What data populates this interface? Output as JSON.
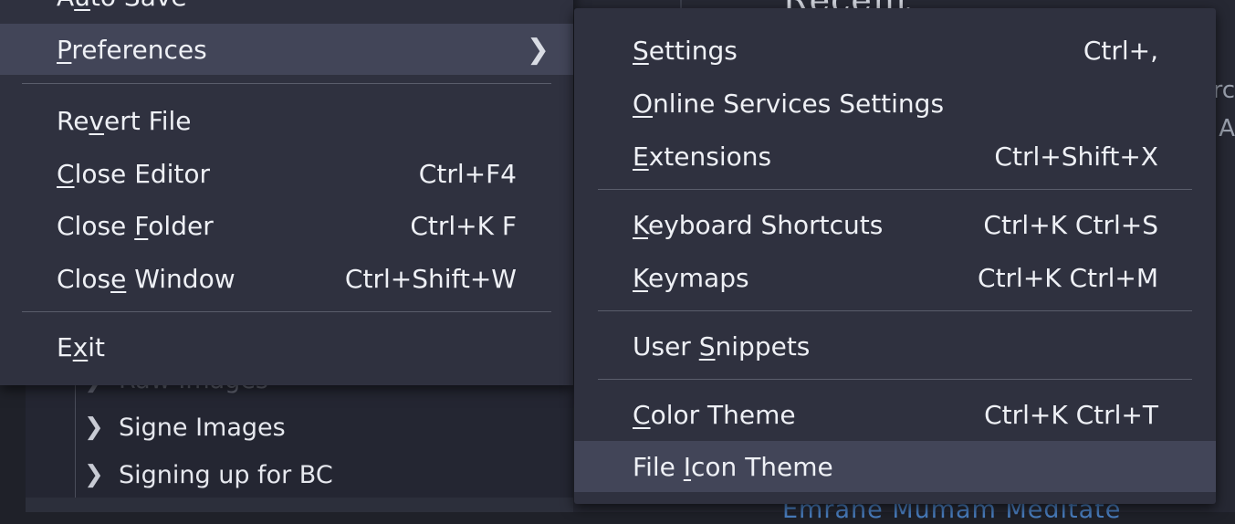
{
  "background": {
    "tree_items": [
      {
        "label": "Raw Images",
        "ghost": true
      },
      {
        "label": "Signe Images",
        "ghost": false
      },
      {
        "label": "Signing up for BC",
        "ghost": false
      }
    ],
    "chevron": "chevron-right-icon",
    "right_heading": "Recent",
    "edge_text_1": "rc",
    "edge_text_2": "A",
    "link_text": "Emrane Mumam Meditate"
  },
  "file_menu": {
    "items": [
      {
        "type": "item",
        "name": "auto-save",
        "label": "Auto Save",
        "mnemonic": {
          "before": "A",
          "key": "u",
          "after": "to Save"
        },
        "shortcut": ""
      },
      {
        "type": "item",
        "name": "preferences",
        "label": "Preferences",
        "mnemonic": {
          "before": "",
          "key": "P",
          "after": "references"
        },
        "shortcut": "",
        "submenu": true,
        "highlighted": true
      },
      {
        "type": "separator"
      },
      {
        "type": "item",
        "name": "revert-file",
        "label": "Revert File",
        "mnemonic": {
          "before": "Re",
          "key": "v",
          "after": "ert File"
        },
        "shortcut": ""
      },
      {
        "type": "item",
        "name": "close-editor",
        "label": "Close Editor",
        "mnemonic": {
          "before": "",
          "key": "C",
          "after": "lose Editor"
        },
        "shortcut": "Ctrl+F4"
      },
      {
        "type": "item",
        "name": "close-folder",
        "label": "Close Folder",
        "mnemonic": {
          "before": "Close ",
          "key": "F",
          "after": "older"
        },
        "shortcut": "Ctrl+K F"
      },
      {
        "type": "item",
        "name": "close-window",
        "label": "Close Window",
        "mnemonic": {
          "before": "Clos",
          "key": "e",
          "after": " Window"
        },
        "shortcut": "Ctrl+Shift+W"
      },
      {
        "type": "separator"
      },
      {
        "type": "item",
        "name": "exit",
        "label": "Exit",
        "mnemonic": {
          "before": "E",
          "key": "x",
          "after": "it"
        },
        "shortcut": ""
      }
    ]
  },
  "preferences_menu": {
    "items": [
      {
        "type": "item",
        "name": "settings",
        "label": "Settings",
        "mnemonic": {
          "before": "",
          "key": "S",
          "after": "ettings"
        },
        "shortcut": "Ctrl+,"
      },
      {
        "type": "item",
        "name": "online-services-settings",
        "label": "Online Services Settings",
        "mnemonic": {
          "before": "",
          "key": "O",
          "after": "nline Services Settings"
        },
        "shortcut": ""
      },
      {
        "type": "item",
        "name": "extensions",
        "label": "Extensions",
        "mnemonic": {
          "before": "",
          "key": "E",
          "after": "xtensions"
        },
        "shortcut": "Ctrl+Shift+X"
      },
      {
        "type": "separator"
      },
      {
        "type": "item",
        "name": "keyboard-shortcuts",
        "label": "Keyboard Shortcuts",
        "mnemonic": {
          "before": "",
          "key": "K",
          "after": "eyboard Shortcuts"
        },
        "shortcut": "Ctrl+K Ctrl+S"
      },
      {
        "type": "item",
        "name": "keymaps",
        "label": "Keymaps",
        "mnemonic": {
          "before": "",
          "key": "K",
          "after": "eymaps"
        },
        "shortcut": "Ctrl+K Ctrl+M"
      },
      {
        "type": "separator"
      },
      {
        "type": "item",
        "name": "user-snippets",
        "label": "User Snippets",
        "mnemonic": {
          "before": "User ",
          "key": "S",
          "after": "nippets"
        },
        "shortcut": ""
      },
      {
        "type": "separator"
      },
      {
        "type": "item",
        "name": "color-theme",
        "label": "Color Theme",
        "mnemonic": {
          "before": "",
          "key": "C",
          "after": "olor Theme"
        },
        "shortcut": "Ctrl+K Ctrl+T"
      },
      {
        "type": "item",
        "name": "file-icon-theme",
        "label": "File Icon Theme",
        "mnemonic": {
          "before": "File ",
          "key": "I",
          "after": "con Theme"
        },
        "shortcut": "",
        "highlighted": true
      }
    ]
  }
}
